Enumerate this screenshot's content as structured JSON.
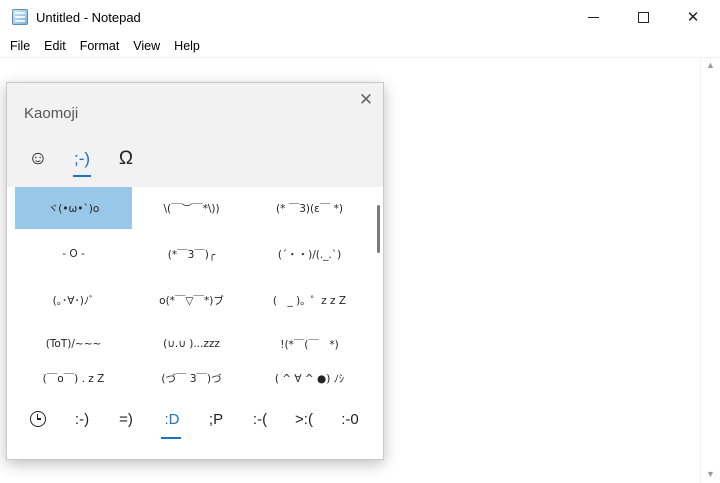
{
  "window": {
    "title": "Untitled - Notepad",
    "icon": "notepad-icon",
    "minimize_icon": "minimize-icon",
    "maximize_icon": "maximize-icon",
    "close_glyph": "✕"
  },
  "menu": {
    "items": [
      "File",
      "Edit",
      "Format",
      "View",
      "Help"
    ]
  },
  "editor": {
    "content": ""
  },
  "panel": {
    "title": "Kaomoji",
    "close_glyph": "✕",
    "categories": [
      {
        "icon": "smiley-icon",
        "glyph": "☺"
      },
      {
        "icon": "kaomoji-icon",
        "glyph": ";-)"
      },
      {
        "icon": "omega-icon",
        "glyph": "Ω"
      }
    ],
    "active_category": ";-)",
    "kaomoji": [
      "ヾ(•ω•`)o",
      "\\(￣︶￣*\\))",
      "(* ￣3)(ε￣ *)",
      "- O -",
      "(*￣3￣)╭",
      "(´・・)/(._.`)",
      "(｡･∀･)ﾉﾞ",
      "o(*￣▽￣*)ブ",
      "(　_ )。゜z z Z",
      "(ToT)/~~~",
      "(∪.∪ )...zzz",
      "!(*￣(￣　*)",
      "(￣o￣) . z Z",
      "(づ￣ 3￣)づ",
      "( ^ ∀ ^ ●) ﾉｼ"
    ],
    "selected_index": 0,
    "subcategories": [
      "recent-clock-icon",
      ":-)",
      "=)",
      ":D",
      ";P",
      ":-(",
      ">:(",
      ":-0"
    ],
    "active_subcategory": ":D"
  },
  "colors": {
    "accent": "#1a73c9",
    "selection": "#99c7ea",
    "panel_bg": "#f2f2f2"
  }
}
